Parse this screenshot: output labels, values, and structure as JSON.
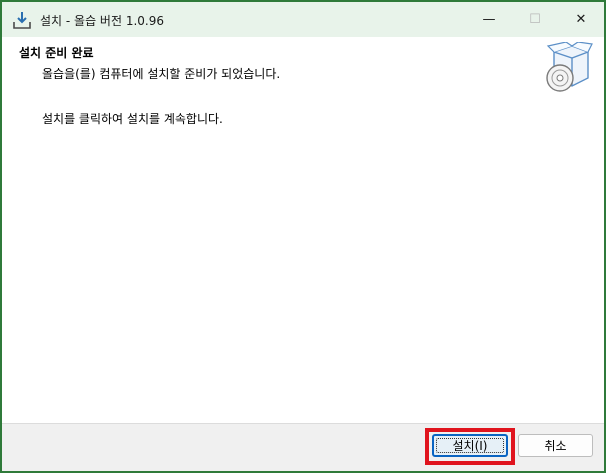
{
  "window": {
    "title": "설치 - 올습 버전 1.0.96",
    "controls": {
      "minimize": "—",
      "maximize": "☐",
      "close": "✕"
    }
  },
  "header": {
    "heading": "설치 준비 완료",
    "subheading": "올습을(를) 컴퓨터에 설치할 준비가 되었습니다."
  },
  "body": {
    "instruction": "설치를 클릭하여 설치를 계속합니다."
  },
  "footer": {
    "install_label": "설치(I)",
    "cancel_label": "취소"
  },
  "colors": {
    "titlebar_bg": "#e8f3ea",
    "window_border": "#2f7a3a",
    "highlight": "#e0141e",
    "focus_blue": "#0a64c2"
  },
  "icons": {
    "app": "install-download-icon",
    "header": "software-box-cd-icon"
  }
}
